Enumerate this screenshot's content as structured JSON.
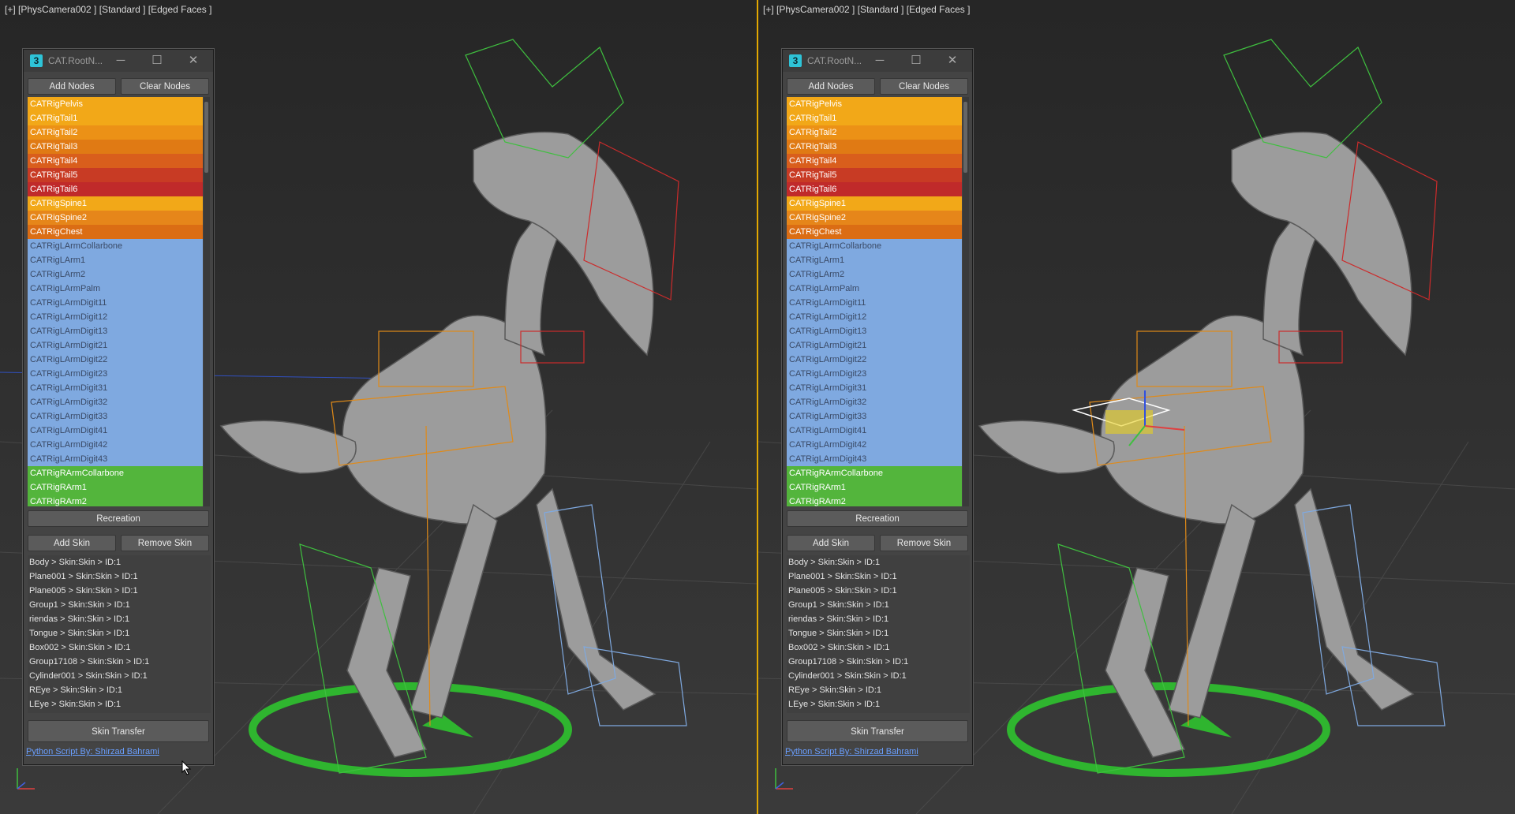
{
  "viewports": [
    {
      "label": "[+] [PhysCamera002 ] [Standard ] [Edged Faces ]"
    },
    {
      "label": "[+] [PhysCamera002 ] [Standard ] [Edged Faces ]"
    }
  ],
  "window": {
    "title": "CAT.RootN...",
    "add_nodes": "Add Nodes",
    "clear_nodes": "Clear Nodes",
    "recreation": "Recreation",
    "add_skin": "Add Skin",
    "remove_skin": "Remove Skin",
    "skin_transfer": "Skin Transfer",
    "credit": "Python Script By: Shirzad Bahrami"
  },
  "nodes": [
    {
      "name": "CATRigPelvis",
      "color": "#f2a818"
    },
    {
      "name": "CATRigTail1",
      "color": "#f2a818"
    },
    {
      "name": "CATRigTail2",
      "color": "#ec9116"
    },
    {
      "name": "CATRigTail3",
      "color": "#e07a14"
    },
    {
      "name": "CATRigTail4",
      "color": "#d95e1c"
    },
    {
      "name": "CATRigTail5",
      "color": "#c83b24"
    },
    {
      "name": "CATRigTail6",
      "color": "#c02a2a"
    },
    {
      "name": "CATRigSpine1",
      "color": "#f2a818"
    },
    {
      "name": "CATRigSpine2",
      "color": "#e6861a"
    },
    {
      "name": "CATRigChest",
      "color": "#db6d14"
    },
    {
      "name": "CATRigLArmCollarbone",
      "color": "#7fa9e0"
    },
    {
      "name": "CATRigLArm1",
      "color": "#7fa9e0"
    },
    {
      "name": "CATRigLArm2",
      "color": "#7fa9e0"
    },
    {
      "name": "CATRigLArmPalm",
      "color": "#7fa9e0"
    },
    {
      "name": "CATRigLArmDigit11",
      "color": "#7fa9e0"
    },
    {
      "name": "CATRigLArmDigit12",
      "color": "#7fa9e0"
    },
    {
      "name": "CATRigLArmDigit13",
      "color": "#7fa9e0"
    },
    {
      "name": "CATRigLArmDigit21",
      "color": "#7fa9e0"
    },
    {
      "name": "CATRigLArmDigit22",
      "color": "#7fa9e0"
    },
    {
      "name": "CATRigLArmDigit23",
      "color": "#7fa9e0"
    },
    {
      "name": "CATRigLArmDigit31",
      "color": "#7fa9e0"
    },
    {
      "name": "CATRigLArmDigit32",
      "color": "#7fa9e0"
    },
    {
      "name": "CATRigLArmDigit33",
      "color": "#7fa9e0"
    },
    {
      "name": "CATRigLArmDigit41",
      "color": "#7fa9e0"
    },
    {
      "name": "CATRigLArmDigit42",
      "color": "#7fa9e0"
    },
    {
      "name": "CATRigLArmDigit43",
      "color": "#7fa9e0"
    },
    {
      "name": "CATRigRArmCollarbone",
      "color": "#53b53c"
    },
    {
      "name": "CATRigRArm1",
      "color": "#53b53c"
    },
    {
      "name": "CATRigRArm2",
      "color": "#53b53c"
    }
  ],
  "skins": [
    "Body > Skin:Skin > ID:1",
    "Plane001 > Skin:Skin > ID:1",
    "Plane005 > Skin:Skin > ID:1",
    "Group1 > Skin:Skin > ID:1",
    "riendas > Skin:Skin > ID:1",
    "Tongue > Skin:Skin > ID:1",
    "Box002 > Skin:Skin > ID:1",
    "Group17108 > Skin:Skin > ID:1",
    "Cylinder001 > Skin:Skin > ID:1",
    "REye > Skin:Skin > ID:1",
    "LEye > Skin:Skin > ID:1"
  ],
  "colors": {
    "viewport_active_border": "#e3a800",
    "rig_root_green": "#2fb52f",
    "mesh_grey": "#bdbdbd",
    "link_blue": "#6a9fff"
  },
  "icons": [
    "window-app-icon",
    "minimize-icon",
    "maximize-icon",
    "close-icon",
    "axis-tripod-icon",
    "mouse-cursor-icon",
    "move-gizmo-icon"
  ]
}
